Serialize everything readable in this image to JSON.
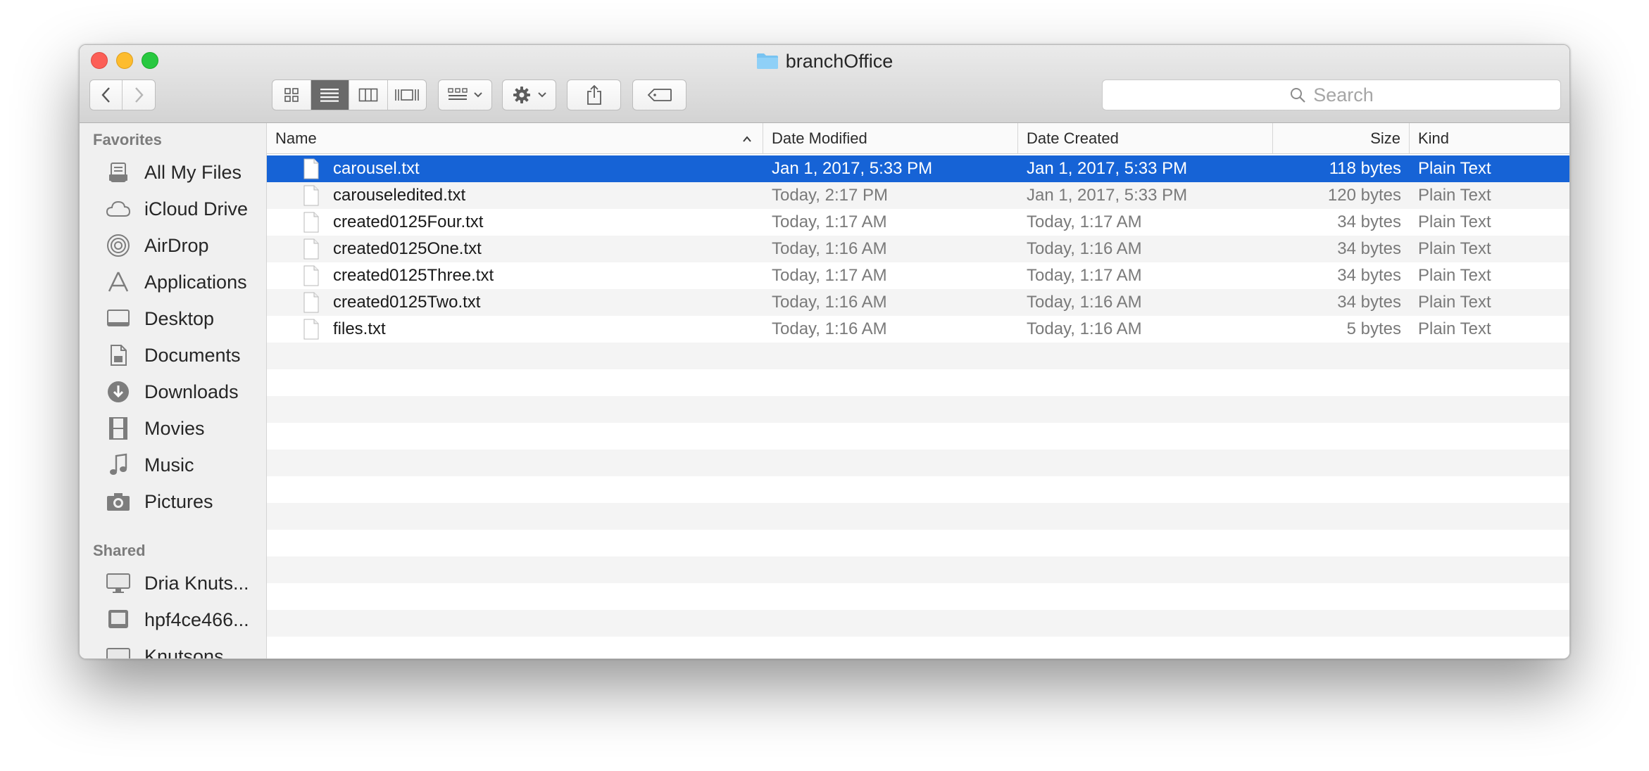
{
  "window": {
    "title": "branchOffice",
    "title_icon": "folder-icon"
  },
  "toolbar": {
    "back_icon": "chevron-left-icon",
    "forward_icon": "chevron-right-icon",
    "view_modes": [
      "icon-view-icon",
      "list-view-icon",
      "column-view-icon",
      "coverflow-view-icon"
    ],
    "active_view": "list-view-icon",
    "arrange_icon": "arrange-grid-icon",
    "action_icon": "gear-icon",
    "share_icon": "share-icon",
    "tag_icon": "tag-icon"
  },
  "search": {
    "placeholder": "Search",
    "icon": "magnifier-icon"
  },
  "sidebar": {
    "favorites_header": "Favorites",
    "favorites": [
      {
        "label": "All My Files",
        "icon": "all-files-icon"
      },
      {
        "label": "iCloud Drive",
        "icon": "cloud-icon"
      },
      {
        "label": "AirDrop",
        "icon": "airdrop-icon"
      },
      {
        "label": "Applications",
        "icon": "applications-icon"
      },
      {
        "label": "Desktop",
        "icon": "desktop-icon"
      },
      {
        "label": "Documents",
        "icon": "documents-icon"
      },
      {
        "label": "Downloads",
        "icon": "downloads-icon"
      },
      {
        "label": "Movies",
        "icon": "film-icon"
      },
      {
        "label": "Music",
        "icon": "music-note-icon"
      },
      {
        "label": "Pictures",
        "icon": "camera-icon"
      }
    ],
    "shared_header": "Shared",
    "shared": [
      {
        "label": "Dria Knuts...",
        "icon": "computer-icon"
      },
      {
        "label": "hpf4ce466...",
        "icon": "monitor-icon"
      },
      {
        "label": "Knutsons...",
        "icon": "display-icon"
      }
    ]
  },
  "columns": {
    "name": "Name",
    "modified": "Date Modified",
    "created": "Date Created",
    "size": "Size",
    "kind": "Kind"
  },
  "files": [
    {
      "name": "carousel.txt",
      "modified": "Jan 1, 2017, 5:33 PM",
      "created": "Jan 1, 2017, 5:33 PM",
      "size": "118 bytes",
      "kind": "Plain Text",
      "selected": true
    },
    {
      "name": "carouseledited.txt",
      "modified": "Today, 2:17 PM",
      "created": "Jan 1, 2017, 5:33 PM",
      "size": "120 bytes",
      "kind": "Plain Text"
    },
    {
      "name": "created0125Four.txt",
      "modified": "Today, 1:17 AM",
      "created": "Today, 1:17 AM",
      "size": "34 bytes",
      "kind": "Plain Text"
    },
    {
      "name": "created0125One.txt",
      "modified": "Today, 1:16 AM",
      "created": "Today, 1:16 AM",
      "size": "34 bytes",
      "kind": "Plain Text"
    },
    {
      "name": "created0125Three.txt",
      "modified": "Today, 1:17 AM",
      "created": "Today, 1:17 AM",
      "size": "34 bytes",
      "kind": "Plain Text"
    },
    {
      "name": "created0125Two.txt",
      "modified": "Today, 1:16 AM",
      "created": "Today, 1:16 AM",
      "size": "34 bytes",
      "kind": "Plain Text"
    },
    {
      "name": "files.txt",
      "modified": "Today, 1:16 AM",
      "created": "Today, 1:16 AM",
      "size": "5 bytes",
      "kind": "Plain Text"
    }
  ],
  "colors": {
    "selection": "#1663d6",
    "close": "#fc5f57",
    "minimize": "#fdbc2e",
    "zoom": "#28c840"
  }
}
